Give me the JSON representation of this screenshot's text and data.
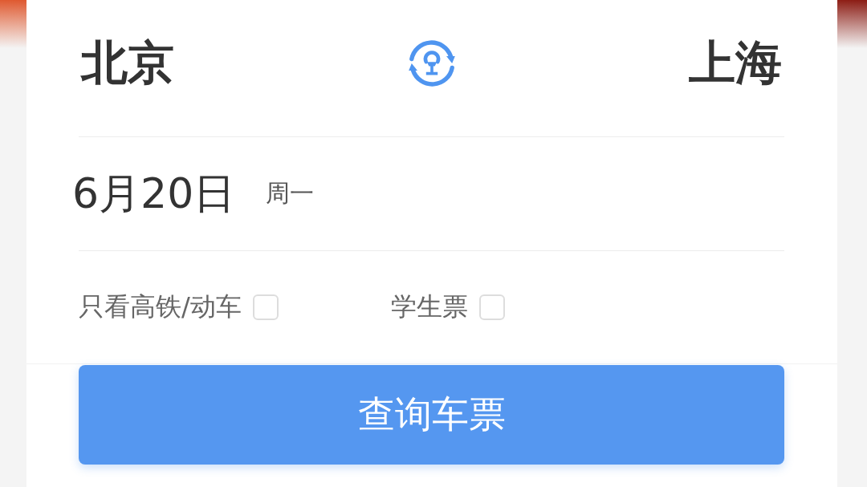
{
  "route": {
    "from": "北京",
    "to": "上海"
  },
  "date": {
    "day": "6月20日",
    "weekday": "周一"
  },
  "options": [
    {
      "label": "只看高铁/动车",
      "checked": false
    },
    {
      "label": "学生票",
      "checked": false
    }
  ],
  "search_button": "查询车票"
}
